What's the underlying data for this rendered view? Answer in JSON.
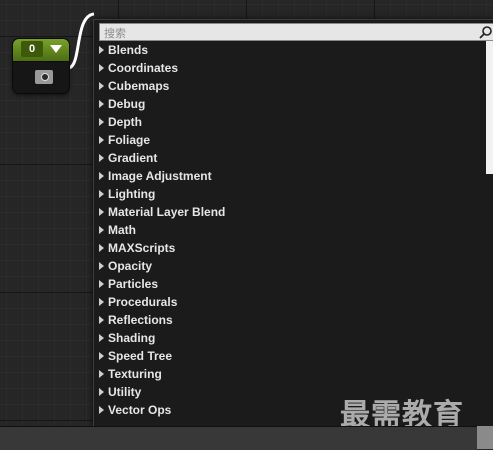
{
  "node": {
    "value": "0",
    "accent_color": "#7aa02a"
  },
  "search": {
    "placeholder": "搜索",
    "value": "",
    "icon": "search-icon"
  },
  "categories": [
    "Blends",
    "Coordinates",
    "Cubemaps",
    "Debug",
    "Depth",
    "Foliage",
    "Gradient",
    "Image Adjustment",
    "Lighting",
    "Material Layer Blend",
    "Math",
    "MAXScripts",
    "Opacity",
    "Particles",
    "Procedurals",
    "Reflections",
    "Shading",
    "Speed Tree",
    "Texturing",
    "Utility",
    "Vector Ops"
  ],
  "watermark": "最需教育"
}
